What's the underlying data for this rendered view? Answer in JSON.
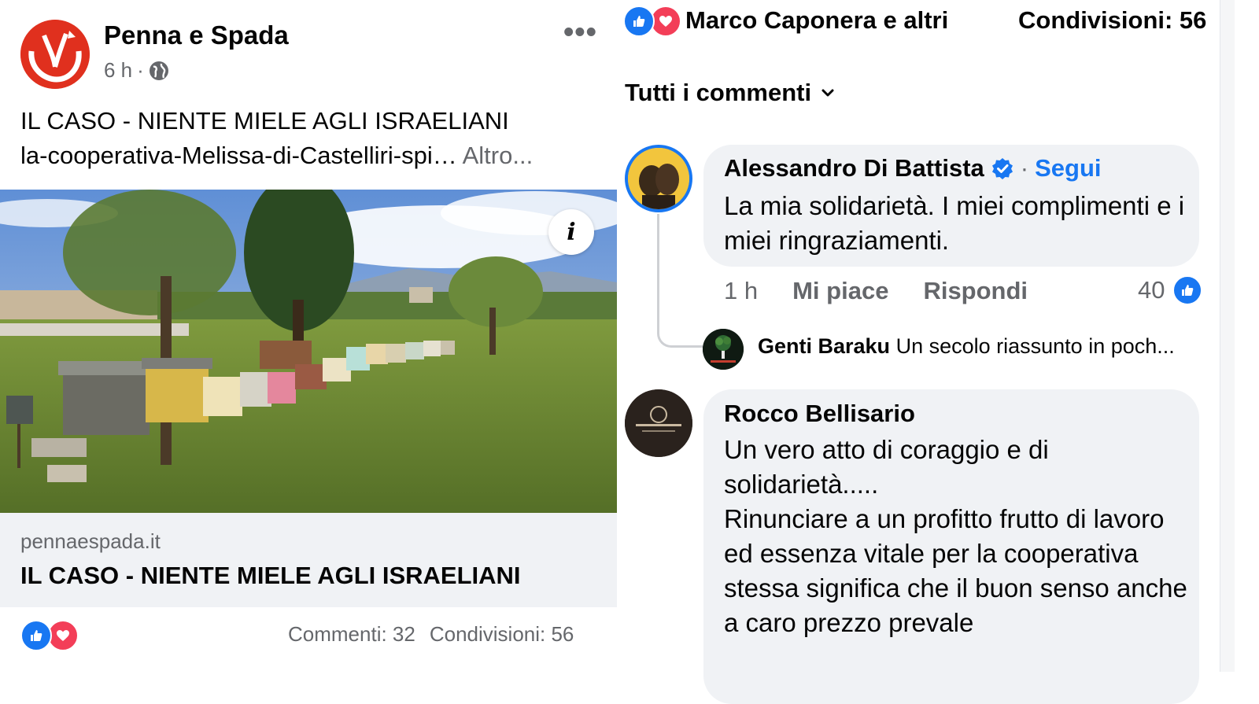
{
  "post": {
    "page_name": "Penna e Spada",
    "time": "6 h",
    "separator": "·",
    "title": "IL CASO - NIENTE MIELE AGLI ISRAELIANI",
    "slug": "la-cooperativa-Melissa-di-Castelliri-spi…",
    "see_more": "Altro...",
    "more_icon": "•••",
    "info_icon": "i",
    "link": {
      "domain": "pennaespada.it",
      "title": "IL CASO - NIENTE MIELE AGLI ISRAELIANI"
    },
    "comments_count": "Commenti: 32",
    "shares_count": "Condivisioni: 56"
  },
  "comments_panel": {
    "reactors": "Marco Caponera e altri",
    "shares": "Condivisioni: 56",
    "sort_label": "Tutti i commenti",
    "comments": [
      {
        "author": "Alessandro Di Battista",
        "follow_label": "Segui",
        "dot": "·",
        "text": "La mia solidarietà. I miei complimenti e i miei ringraziamenti.",
        "time": "1 h",
        "like_label": "Mi piace",
        "reply_label": "Rispondi",
        "likes": "40",
        "reply": {
          "author": "Genti Baraku",
          "preview": "Un secolo riassunto in poch..."
        }
      },
      {
        "author": "Rocco Bellisario",
        "text": "Un vero atto di coraggio e di solidarietà.....\nRinunciare a un profitto frutto di lavoro ed essenza vitale per la cooperativa stessa significa che il buon senso anche a caro prezzo prevale"
      }
    ]
  },
  "colors": {
    "accent": "#1877f2",
    "love": "#f33e58",
    "brand_red": "#e0301e",
    "bubble": "#f0f2f5",
    "secondary_text": "#65676b"
  },
  "icons": [
    "more-icon",
    "globe-icon",
    "info-icon",
    "like-reaction-icon",
    "love-reaction-icon",
    "chevron-down-icon",
    "verified-badge-icon"
  ]
}
